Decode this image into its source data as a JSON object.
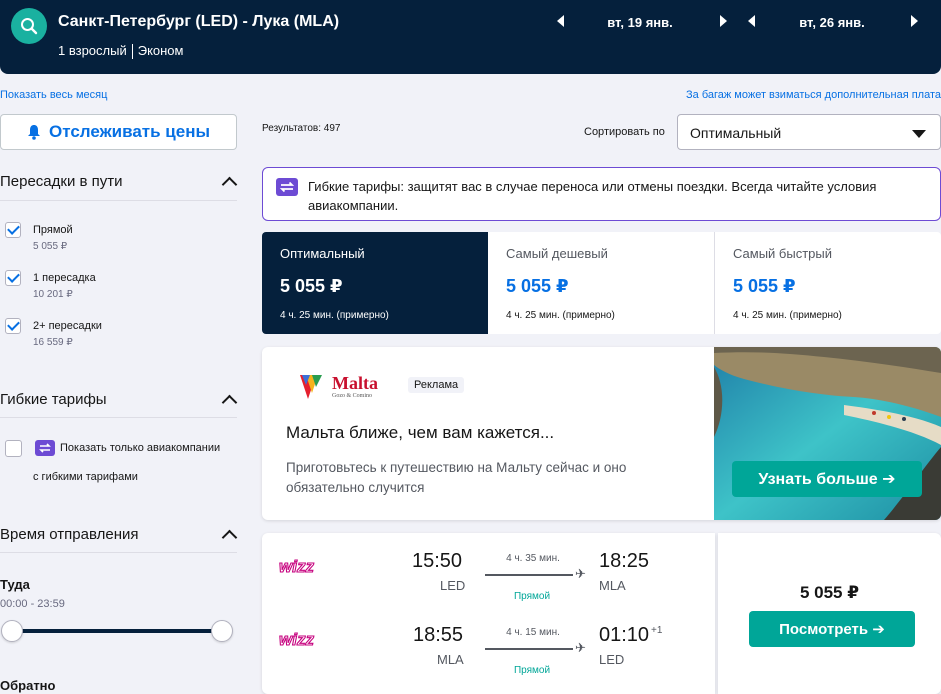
{
  "header": {
    "route": "Санкт-Петербург (LED) - Лука (MLA)",
    "passengers": "1 взрослый",
    "cabin": "Эконом",
    "depart_date": "вт, 19 янв.",
    "return_date": "вт, 26 янв."
  },
  "links": {
    "whole_month": "Показать весь месяц",
    "baggage_fee": "За багаж может взиматься дополнительная плата"
  },
  "sidebar": {
    "track_prices": "Отслеживать цены",
    "stops_title": "Пересадки в пути",
    "stops": [
      {
        "label": "Прямой",
        "price": "5 055 ₽",
        "checked": true
      },
      {
        "label": "1 пересадка",
        "price": "10 201 ₽",
        "checked": true
      },
      {
        "label": "2+ пересадки",
        "price": "16 559 ₽",
        "checked": true
      }
    ],
    "flex_title": "Гибкие тарифы",
    "flex_option_line1": "Показать только авиакомпании",
    "flex_option_line2": "с гибкими тарифами",
    "time_title": "Время отправления",
    "outbound_label": "Туда",
    "outbound_range": "00:00 - 23:59",
    "return_label": "Обратно"
  },
  "main": {
    "results_count": "Результатов: 497",
    "sort_label": "Сортировать по",
    "sort_value": "Оптимальный",
    "flex_notice": "Гибкие тарифы: защитят вас в случае переноса или отмены поездки. Всегда читайте условия авиакомпании.",
    "tabs": [
      {
        "name": "Оптимальный",
        "price": "5 055 ₽",
        "duration": "4 ч. 25 мин. (примерно)",
        "active": true
      },
      {
        "name": "Самый дешевый",
        "price": "5 055 ₽",
        "duration": "4 ч. 25 мин. (примерно)",
        "active": false
      },
      {
        "name": "Самый быстрый",
        "price": "5 055 ₽",
        "duration": "4 ч. 25 мин. (примерно)",
        "active": false
      }
    ]
  },
  "ad": {
    "brand": "Malta",
    "brand_sub": "Gozo & Comino",
    "badge": "Реклама",
    "title": "Мальта ближе, чем вам кажется...",
    "subtitle": "Приготовьтесь к путешествию на Мальту сейчас и оно обязательно случится",
    "cta": "Узнать больше ➔"
  },
  "flight": {
    "airline": "wizz",
    "legs": [
      {
        "dep_time": "15:50",
        "dep_apt": "LED",
        "duration": "4 ч. 35 мин.",
        "stops": "Прямой",
        "arr_time": "18:25",
        "arr_apt": "MLA",
        "day_offset": ""
      },
      {
        "dep_time": "18:55",
        "dep_apt": "MLA",
        "duration": "4 ч. 15 мин.",
        "stops": "Прямой",
        "arr_time": "01:10",
        "arr_apt": "LED",
        "day_offset": "+1"
      }
    ],
    "price": "5 055 ₽",
    "view_button": "Посмотреть ➔"
  },
  "colors": {
    "header_bg": "#05203c",
    "accent_teal": "#00a698",
    "link_blue": "#0770e3",
    "flex_purple": "#6d4bd4",
    "wizz_magenta": "#c6007e"
  }
}
